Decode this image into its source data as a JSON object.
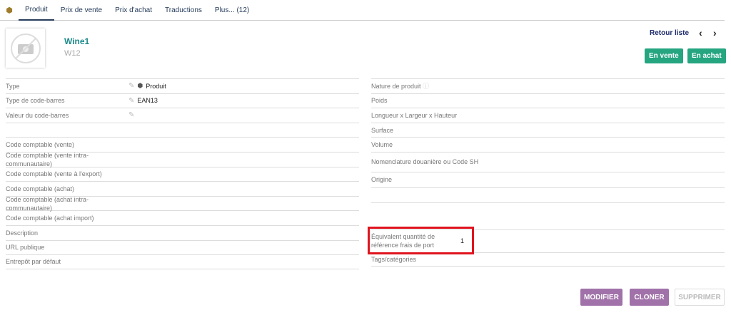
{
  "tabs": [
    "Produit",
    "Prix de vente",
    "Prix d'achat",
    "Traductions",
    "Plus... (12)"
  ],
  "header": {
    "ref": "Wine1",
    "label": "W12",
    "back": "Retour liste",
    "prev": "‹",
    "next": "›",
    "on_sale": "En vente",
    "on_buy": "En achat"
  },
  "left": [
    {
      "label": "Type",
      "value": "Produit",
      "edit": true,
      "icon": "cube-icon"
    },
    {
      "label": "Type de code-barres",
      "value": "EAN13",
      "edit": true
    },
    {
      "label": "Valeur du code-barres",
      "value": "",
      "edit": true
    },
    {
      "label": "",
      "value": ""
    },
    {
      "label": "Code comptable (vente)"
    },
    {
      "label": "Code comptable (vente intra-communautaire)"
    },
    {
      "label": "Code comptable (vente à l'export)"
    },
    {
      "label": "Code comptable (achat)"
    },
    {
      "label": "Code comptable (achat intra-communautaire)"
    },
    {
      "label": "Code comptable (achat import)"
    },
    {
      "label": "Description"
    },
    {
      "label": "URL publique"
    },
    {
      "label": "Entrepôt par défaut"
    }
  ],
  "right": [
    {
      "label": "Nature de produit"
    },
    {
      "label": "Poids"
    },
    {
      "label": "Longueur x Largeur x Hauteur"
    },
    {
      "label": "Surface"
    },
    {
      "label": "Volume"
    },
    {
      "label": "Nomenclature douanière ou Code SH"
    },
    {
      "label": "Origine"
    },
    {
      "label": ""
    },
    {
      "label": ""
    },
    {
      "label": "Équivalent quantité de référence frais de port",
      "value": "1"
    },
    {
      "label": "Tags/catégories"
    }
  ],
  "actions": {
    "modify": "MODIFIER",
    "clone": "CLONER",
    "delete": "SUPPRIMER"
  }
}
